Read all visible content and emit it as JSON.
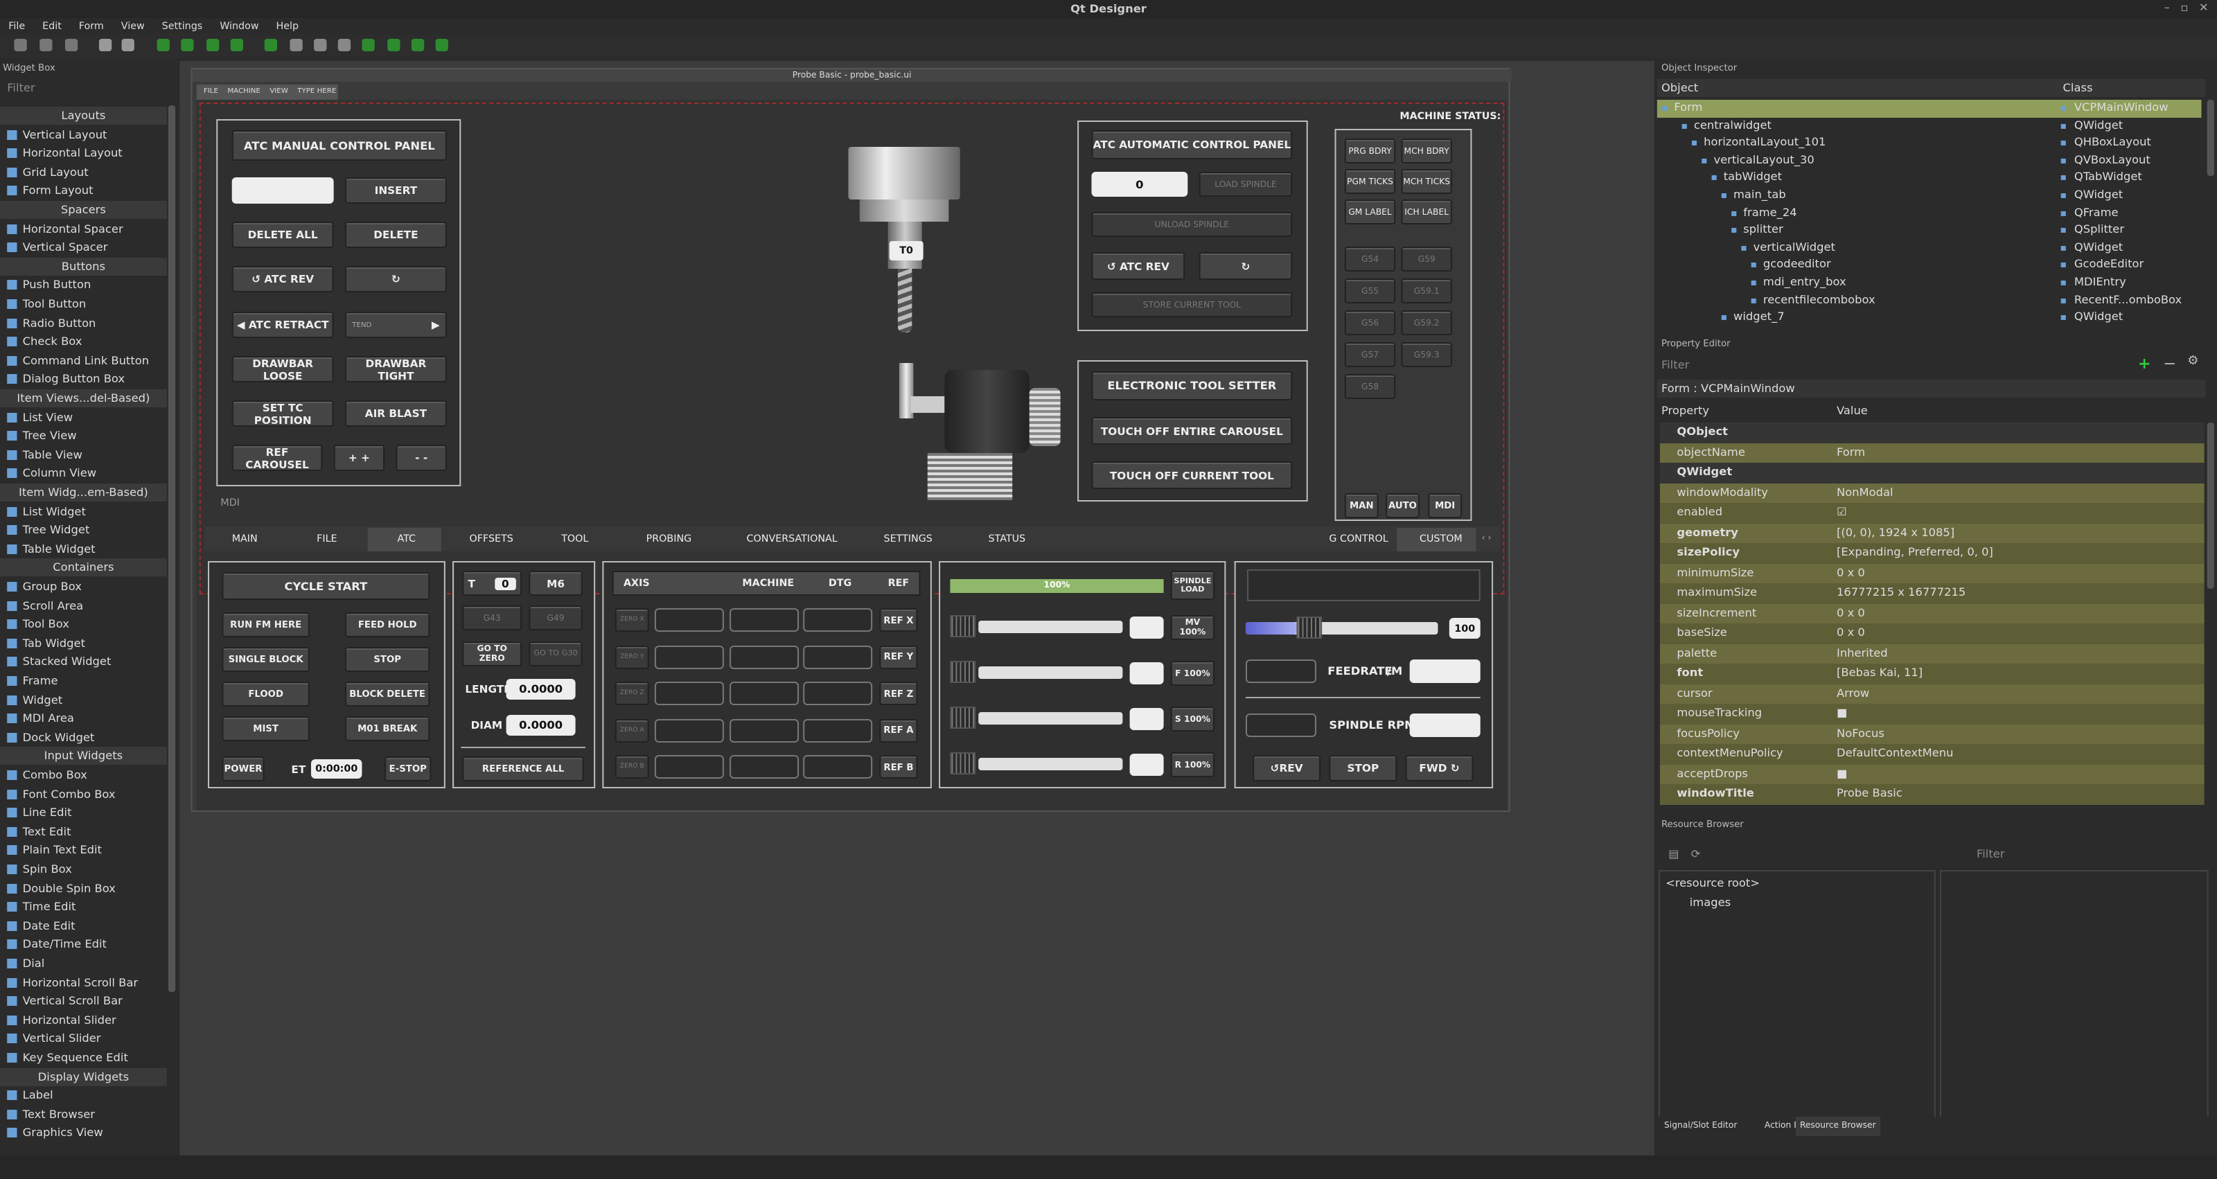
{
  "app": {
    "title": "Qt Designer"
  },
  "menu": [
    "File",
    "Edit",
    "Form",
    "View",
    "Settings",
    "Window",
    "Help"
  ],
  "toolbar_icons": [
    "qt-icon"
  ],
  "widget_box": {
    "title": "Widget Box",
    "filter_placeholder": "Filter",
    "items": [
      {
        "label": "Layouts",
        "cat": true
      },
      {
        "label": "Vertical Layout"
      },
      {
        "label": "Horizontal Layout"
      },
      {
        "label": "Grid Layout"
      },
      {
        "label": "Form Layout"
      },
      {
        "label": "Spacers",
        "cat": true
      },
      {
        "label": "Horizontal Spacer"
      },
      {
        "label": "Vertical Spacer"
      },
      {
        "label": "Buttons",
        "cat": true
      },
      {
        "label": "Push Button"
      },
      {
        "label": "Tool Button"
      },
      {
        "label": "Radio Button"
      },
      {
        "label": "Check Box"
      },
      {
        "label": "Command Link Button"
      },
      {
        "label": "Dialog Button Box"
      },
      {
        "label": "Item Views...del-Based)",
        "cat": true
      },
      {
        "label": "List View"
      },
      {
        "label": "Tree View"
      },
      {
        "label": "Table View"
      },
      {
        "label": "Column View"
      },
      {
        "label": "Item Widg...em-Based)",
        "cat": true
      },
      {
        "label": "List Widget"
      },
      {
        "label": "Tree Widget"
      },
      {
        "label": "Table Widget"
      },
      {
        "label": "Containers",
        "cat": true
      },
      {
        "label": "Group Box"
      },
      {
        "label": "Scroll Area"
      },
      {
        "label": "Tool Box"
      },
      {
        "label": "Tab Widget"
      },
      {
        "label": "Stacked Widget"
      },
      {
        "label": "Frame"
      },
      {
        "label": "Widget"
      },
      {
        "label": "MDI Area"
      },
      {
        "label": "Dock Widget"
      },
      {
        "label": "Input Widgets",
        "cat": true
      },
      {
        "label": "Combo Box"
      },
      {
        "label": "Font Combo Box"
      },
      {
        "label": "Line Edit"
      },
      {
        "label": "Text Edit"
      },
      {
        "label": "Plain Text Edit"
      },
      {
        "label": "Spin Box"
      },
      {
        "label": "Double Spin Box"
      },
      {
        "label": "Time Edit"
      },
      {
        "label": "Date Edit"
      },
      {
        "label": "Date/Time Edit"
      },
      {
        "label": "Dial"
      },
      {
        "label": "Horizontal Scroll Bar"
      },
      {
        "label": "Vertical Scroll Bar"
      },
      {
        "label": "Horizontal Slider"
      },
      {
        "label": "Vertical Slider"
      },
      {
        "label": "Key Sequence Edit"
      },
      {
        "label": "Display Widgets",
        "cat": true
      },
      {
        "label": "Label"
      },
      {
        "label": "Text Browser"
      },
      {
        "label": "Graphics View"
      }
    ]
  },
  "form": {
    "title": "Probe Basic - probe_basic.ui",
    "menu": [
      "FILE",
      "MACHINE",
      "VIEW",
      "TYPE HERE"
    ],
    "atc_manual": {
      "title": "ATC MANUAL CONTROL PANEL",
      "insert": "INSERT",
      "delete_all": "DELETE ALL",
      "delete": "DELETE",
      "atc_rev": "ATC REV",
      "atc_retract": "ATC RETRACT",
      "tend": "TEND",
      "drawbar_loose": "DRAWBAR LOOSE",
      "drawbar_tight": "DRAWBAR TIGHT",
      "set_tc": "SET TC POSITION",
      "air_blast": "AIR BLAST",
      "ref_carousel": "REF CAROUSEL",
      "plus": "+ +",
      "minus": "- -"
    },
    "mdi_label": "MDI",
    "tool_label": "T0",
    "atc_auto": {
      "title": "ATC AUTOMATIC CONTROL PANEL",
      "value": "0",
      "load_spindle": "LOAD SPINDLE",
      "unload_spindle": "UNLOAD SPINDLE",
      "atc_rev": "ATC REV",
      "store": "STORE CURRENT TOOL"
    },
    "ets": {
      "title": "ELECTRONIC TOOL SETTER",
      "touch_all": "TOUCH OFF ENTIRE CAROUSEL",
      "touch_current": "TOUCH OFF CURRENT TOOL"
    },
    "machine_status": {
      "title": "MACHINE STATUS:",
      "cells": [
        "PRG BDRY",
        "MCH BDRY",
        "PGM TICKS",
        "MCH TICKS",
        "GM LABEL",
        "ICH LABEL",
        "G54",
        "G59",
        "G55",
        "G59.1",
        "G56",
        "G59.2",
        "G57",
        "G59.3",
        "G58"
      ],
      "modes": [
        "MAN",
        "AUTO",
        "MDI"
      ]
    },
    "tabs": [
      "MAIN",
      "FILE",
      "ATC",
      "OFFSETS",
      "TOOL",
      "PROBING",
      "CONVERSATIONAL",
      "SETTINGS",
      "STATUS",
      "G CONTROL",
      "CUSTOM"
    ],
    "cycle": {
      "cycle_start": "CYCLE START",
      "run_from_here": "RUN FM HERE",
      "feed_hold": "FEED HOLD",
      "single_block": "SINGLE BLOCK",
      "stop": "STOP",
      "flood": "FLOOD",
      "block_delete": "BLOCK DELETE",
      "mist": "MIST",
      "m01": "M01 BREAK",
      "power": "POWER",
      "et_label": "ET",
      "et_value": "0:00:00",
      "estop": "E-STOP"
    },
    "tool": {
      "t": "T",
      "t_value": "0",
      "m6": "M6",
      "g43": "G43",
      "g49": "G49",
      "go_zero": "GO TO ZERO",
      "go_g30": "GO TO G30",
      "length": "LENGTH",
      "length_value": "0.0000",
      "diam": "DIAM",
      "diam_value": "0.0000",
      "ref_all": "REFERENCE ALL"
    },
    "dro": {
      "headers": [
        "AXIS",
        "MACHINE",
        "DTG",
        "REF"
      ],
      "zero_labels": [
        "ZERO X",
        "ZERO Y",
        "ZERO Z",
        "ZERO A",
        "ZERO B"
      ],
      "ref": [
        "REF X",
        "REF Y",
        "REF Z",
        "REF A",
        "REF B"
      ]
    },
    "overrides": {
      "spindle_pct": "100%",
      "spindle_load": "SPINDLE LOAD",
      "rows": [
        "MV 100%",
        "F 100%",
        "S 100%",
        "R 100%"
      ]
    },
    "spindle": {
      "value": "100",
      "feedrate": "FEEDRATE",
      "per_min": "/M",
      "rpm": "SPINDLE RPM",
      "rev": "REV",
      "stop": "STOP",
      "fwd": "FWD"
    }
  },
  "object_inspector": {
    "title": "Object Inspector",
    "cols": [
      "Object",
      "Class"
    ],
    "rows": [
      [
        "Form",
        "VCPMainWindow"
      ],
      [
        "centralwidget",
        "QWidget"
      ],
      [
        "horizontalLayout_101",
        "QHBoxLayout"
      ],
      [
        "verticalLayout_30",
        "QVBoxLayout"
      ],
      [
        "tabWidget",
        "QTabWidget"
      ],
      [
        "main_tab",
        "QWidget"
      ],
      [
        "frame_24",
        "QFrame"
      ],
      [
        "splitter",
        "QSplitter"
      ],
      [
        "verticalWidget",
        "QWidget"
      ],
      [
        "gcodeeditor",
        "GcodeEditor"
      ],
      [
        "mdi_entry_box",
        "MDIEntry"
      ],
      [
        "recentfilecombobox",
        "RecentF...omboBox"
      ],
      [
        "widget_7",
        "QWidget"
      ]
    ]
  },
  "property_editor": {
    "title": "Property Editor",
    "filter_placeholder": "Filter",
    "context": "Form : VCPMainWindow",
    "cols": [
      "Property",
      "Value"
    ],
    "rows": [
      [
        "QObject",
        "",
        1
      ],
      [
        "objectName",
        "Form",
        0
      ],
      [
        "QWidget",
        "",
        1
      ],
      [
        "windowModality",
        "NonModal",
        0
      ],
      [
        "enabled",
        "☑",
        0
      ],
      [
        "geometry",
        "[(0, 0), 1924 x 1085]",
        2
      ],
      [
        "sizePolicy",
        "[Expanding, Preferred, 0, 0]",
        2
      ],
      [
        "minimumSize",
        "0 x 0",
        0
      ],
      [
        "maximumSize",
        "16777215 x 16777215",
        0
      ],
      [
        "sizeIncrement",
        "0 x 0",
        0
      ],
      [
        "baseSize",
        "0 x 0",
        0
      ],
      [
        "palette",
        "Inherited",
        0
      ],
      [
        "font",
        "[Bebas Kai, 11]",
        2
      ],
      [
        "cursor",
        "Arrow",
        0
      ],
      [
        "mouseTracking",
        "■",
        0
      ],
      [
        "focusPolicy",
        "NoFocus",
        0
      ],
      [
        "contextMenuPolicy",
        "DefaultContextMenu",
        0
      ],
      [
        "acceptDrops",
        "■",
        0
      ],
      [
        "windowTitle",
        "Probe Basic",
        2
      ]
    ]
  },
  "resource_browser": {
    "title": "Resource Browser",
    "filter_placeholder": "Filter",
    "root": "<resource root>",
    "child": "images"
  },
  "bottom_tabs": [
    "Signal/Slot Editor",
    "Action Editor",
    "Resource Browser"
  ],
  "colors": {
    "highlight": "#8f9e5a",
    "row_olive": "#6b6b3f",
    "accent_green": "#2e8b2e"
  }
}
